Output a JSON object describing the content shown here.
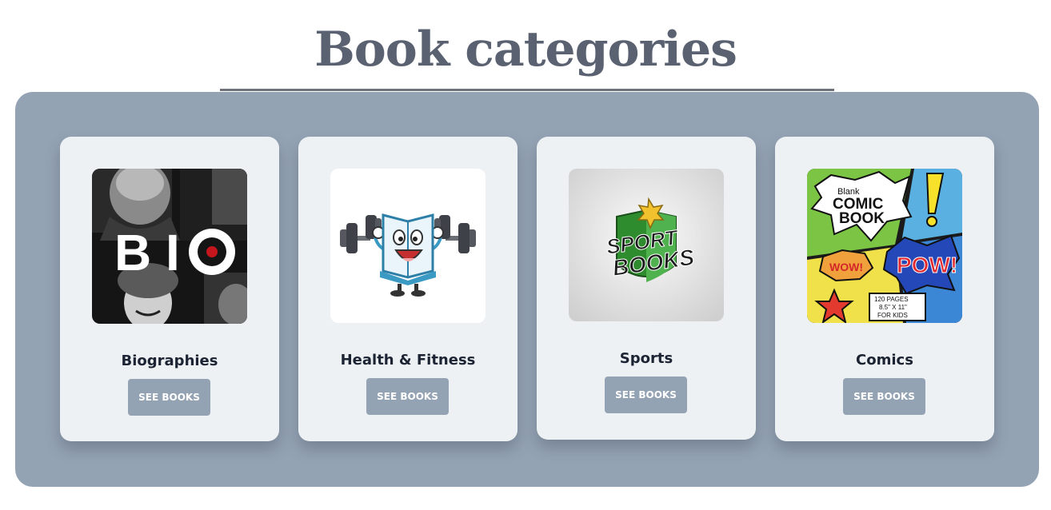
{
  "page": {
    "title": "Book categories"
  },
  "categories": [
    {
      "title": "Biographies",
      "button_label": "SEE BOOKS",
      "image_text": "BIO"
    },
    {
      "title": "Health & Fitness",
      "button_label": "SEE BOOKS"
    },
    {
      "title": "Sports",
      "button_label": "SEE BOOKS",
      "image_text": [
        "SPORT",
        "BOOKS"
      ]
    },
    {
      "title": "Comics",
      "button_label": "SEE BOOKS",
      "image_text": [
        "Blank",
        "COMIC",
        "BOOK",
        "WOW!",
        "POW!",
        "120 PAGES",
        "8.5\" X 11\"",
        "FOR KIDS"
      ]
    }
  ],
  "colors": {
    "panel": "#94a3b4",
    "card": "#edf1f4",
    "title": "#5a6170",
    "button": "#94a3b4"
  }
}
